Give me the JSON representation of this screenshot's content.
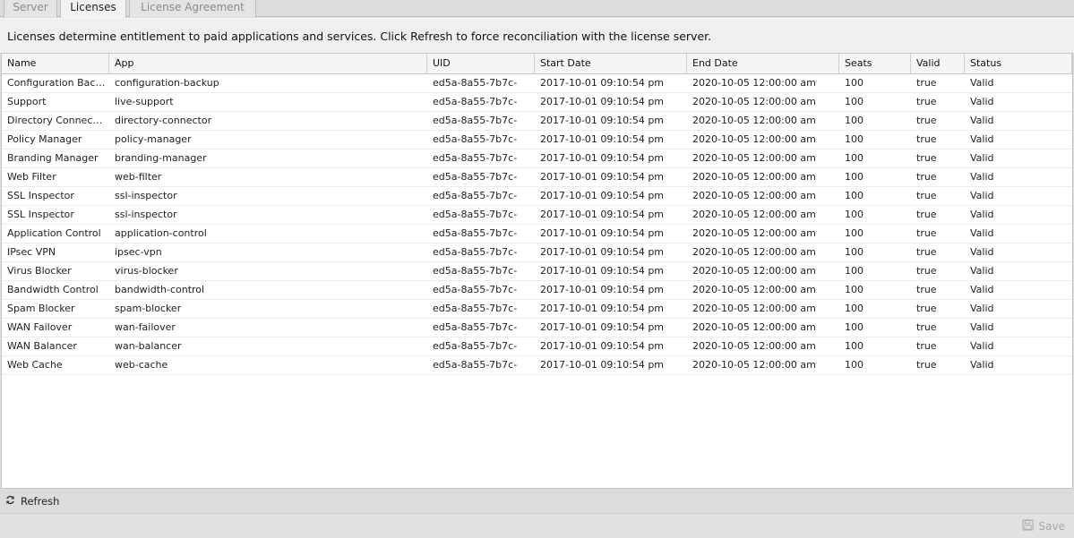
{
  "tabs": [
    {
      "label": "Server"
    },
    {
      "label": "Licenses"
    },
    {
      "label": "License Agreement"
    }
  ],
  "description": "Licenses determine entitlement to paid applications and services. Click Refresh to force reconciliation with the license server.",
  "grid": {
    "columns": [
      "Name",
      "App",
      "UID",
      "Start Date",
      "End Date",
      "Seats",
      "Valid",
      "Status"
    ],
    "rows": [
      [
        "Configuration Backup",
        "configuration-backup",
        "ed5a-8a55-7b7c-",
        "2017-10-01 09:10:54 pm",
        "2020-10-05 12:00:00 am",
        "100",
        "true",
        "Valid"
      ],
      [
        "Support",
        "live-support",
        "ed5a-8a55-7b7c-",
        "2017-10-01 09:10:54 pm",
        "2020-10-05 12:00:00 am",
        "100",
        "true",
        "Valid"
      ],
      [
        "Directory Connector",
        "directory-connector",
        "ed5a-8a55-7b7c-",
        "2017-10-01 09:10:54 pm",
        "2020-10-05 12:00:00 am",
        "100",
        "true",
        "Valid"
      ],
      [
        "Policy Manager",
        "policy-manager",
        "ed5a-8a55-7b7c-",
        "2017-10-01 09:10:54 pm",
        "2020-10-05 12:00:00 am",
        "100",
        "true",
        "Valid"
      ],
      [
        "Branding Manager",
        "branding-manager",
        "ed5a-8a55-7b7c-",
        "2017-10-01 09:10:54 pm",
        "2020-10-05 12:00:00 am",
        "100",
        "true",
        "Valid"
      ],
      [
        "Web Filter",
        "web-filter",
        "ed5a-8a55-7b7c-",
        "2017-10-01 09:10:54 pm",
        "2020-10-05 12:00:00 am",
        "100",
        "true",
        "Valid"
      ],
      [
        "SSL Inspector",
        "ssl-inspector",
        "ed5a-8a55-7b7c-",
        "2017-10-01 09:10:54 pm",
        "2020-10-05 12:00:00 am",
        "100",
        "true",
        "Valid"
      ],
      [
        "SSL Inspector",
        "ssl-inspector",
        "ed5a-8a55-7b7c-",
        "2017-10-01 09:10:54 pm",
        "2020-10-05 12:00:00 am",
        "100",
        "true",
        "Valid"
      ],
      [
        "Application Control",
        "application-control",
        "ed5a-8a55-7b7c-",
        "2017-10-01 09:10:54 pm",
        "2020-10-05 12:00:00 am",
        "100",
        "true",
        "Valid"
      ],
      [
        "IPsec VPN",
        "ipsec-vpn",
        "ed5a-8a55-7b7c-",
        "2017-10-01 09:10:54 pm",
        "2020-10-05 12:00:00 am",
        "100",
        "true",
        "Valid"
      ],
      [
        "Virus Blocker",
        "virus-blocker",
        "ed5a-8a55-7b7c-",
        "2017-10-01 09:10:54 pm",
        "2020-10-05 12:00:00 am",
        "100",
        "true",
        "Valid"
      ],
      [
        "Bandwidth Control",
        "bandwidth-control",
        "ed5a-8a55-7b7c-",
        "2017-10-01 09:10:54 pm",
        "2020-10-05 12:00:00 am",
        "100",
        "true",
        "Valid"
      ],
      [
        "Spam Blocker",
        "spam-blocker",
        "ed5a-8a55-7b7c-",
        "2017-10-01 09:10:54 pm",
        "2020-10-05 12:00:00 am",
        "100",
        "true",
        "Valid"
      ],
      [
        "WAN Failover",
        "wan-failover",
        "ed5a-8a55-7b7c-",
        "2017-10-01 09:10:54 pm",
        "2020-10-05 12:00:00 am",
        "100",
        "true",
        "Valid"
      ],
      [
        "WAN Balancer",
        "wan-balancer",
        "ed5a-8a55-7b7c-",
        "2017-10-01 09:10:54 pm",
        "2020-10-05 12:00:00 am",
        "100",
        "true",
        "Valid"
      ],
      [
        "Web Cache",
        "web-cache",
        "ed5a-8a55-7b7c-",
        "2017-10-01 09:10:54 pm",
        "2020-10-05 12:00:00 am",
        "100",
        "true",
        "Valid"
      ]
    ]
  },
  "toolbar": {
    "refresh_label": "Refresh",
    "refresh_icon": "refresh-icon"
  },
  "footer": {
    "save_label": "Save",
    "save_icon": "floppy-disk-icon"
  }
}
